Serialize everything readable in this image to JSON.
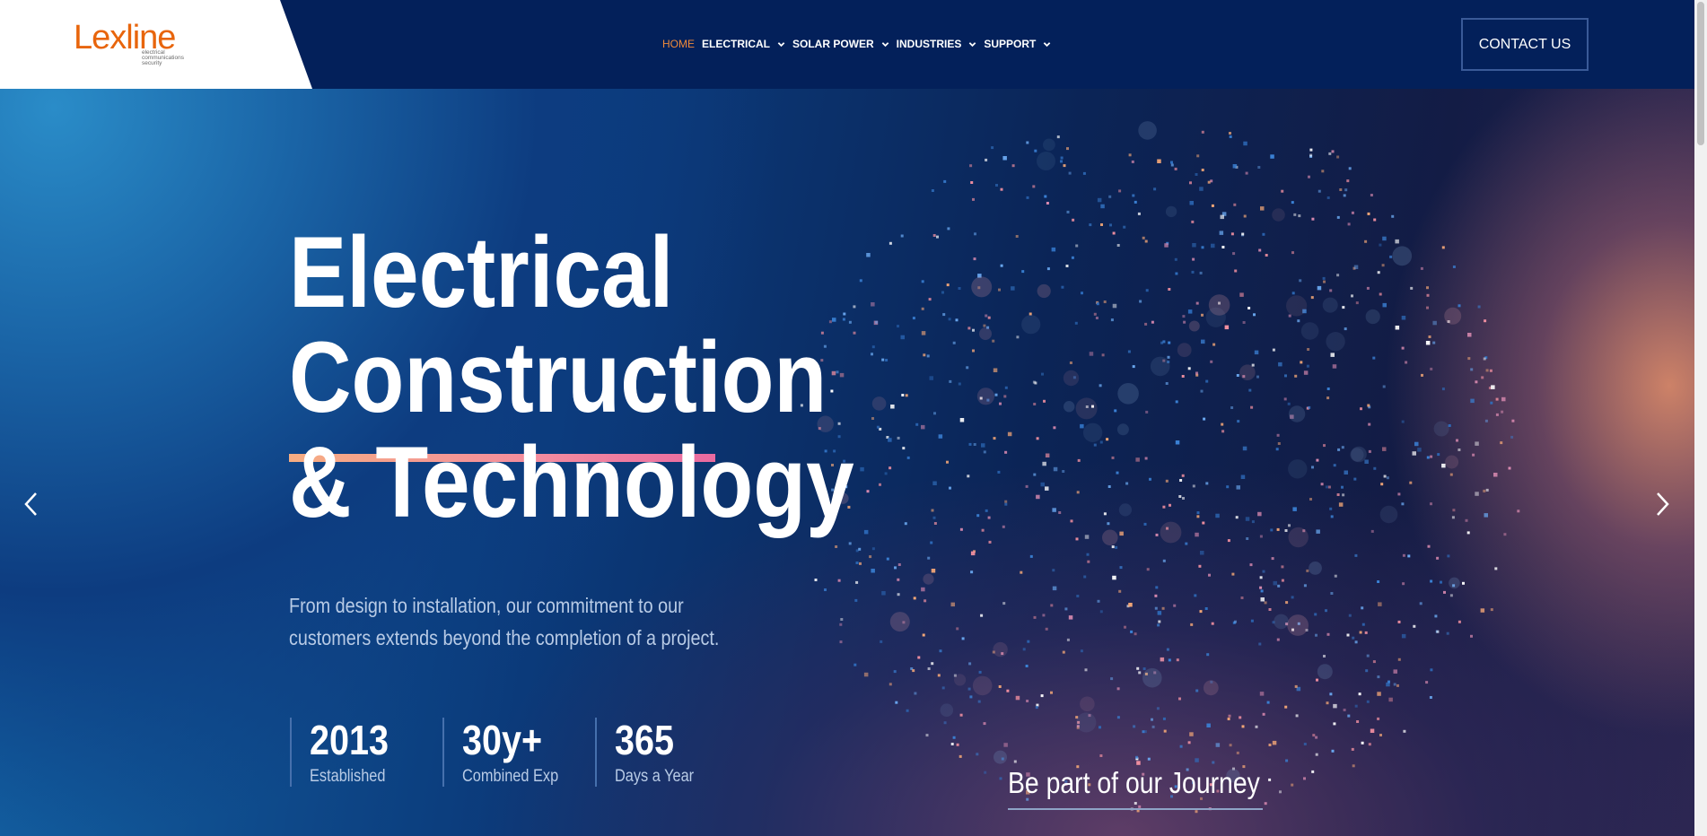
{
  "header": {
    "logo_text": "Lexline",
    "logo_sub": [
      "electrical",
      "communications",
      "security"
    ],
    "nav": [
      {
        "label": "HOME",
        "active": true,
        "has_dropdown": false
      },
      {
        "label": "ELECTRICAL",
        "active": false,
        "has_dropdown": true
      },
      {
        "label": "SOLAR POWER",
        "active": false,
        "has_dropdown": true
      },
      {
        "label": "INDUSTRIES",
        "active": false,
        "has_dropdown": true
      },
      {
        "label": "SUPPORT",
        "active": false,
        "has_dropdown": true
      }
    ],
    "contact_label": "CONTACT US"
  },
  "hero": {
    "title_lines": [
      "Electrical",
      "Construction",
      "& Technology"
    ],
    "description": "From design to installation, our commitment to our customers extends beyond the completion of a project.",
    "stats": [
      {
        "value": "2013",
        "label": "Established"
      },
      {
        "value": "30y+",
        "label": "Combined Exp"
      },
      {
        "value": "365",
        "label": "Days a Year"
      }
    ],
    "journey_link": "Be part of our Journey"
  },
  "slider": {
    "prev_icon": "chevron-left-icon",
    "next_icon": "chevron-right-icon"
  },
  "colors": {
    "header_bg": "#03205a",
    "accent_orange": "#e8650c",
    "nav_active": "#f08a3a",
    "underline_start": "#f6ad82",
    "underline_end": "#e96aa0"
  }
}
